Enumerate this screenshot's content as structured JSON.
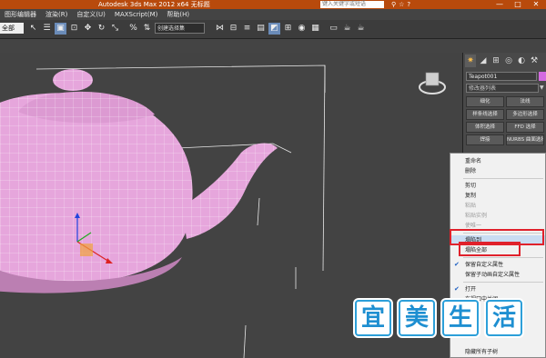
{
  "titlebar": {
    "title": "Autodesk 3ds Max  2012 x64    无标题",
    "search_placeholder": "键入关键字或短语",
    "icons": [
      "binoculars-icon",
      "star-icon",
      "help-icon"
    ],
    "window_buttons": [
      "—",
      "□",
      "✕"
    ]
  },
  "menubar": {
    "items": [
      "图形编辑器",
      "渲染(R)",
      "自定义(U)",
      "MAXScript(M)",
      "帮助(H)"
    ]
  },
  "toolbar": {
    "selection_set": "全部",
    "render_dropdown": "创建选择集"
  },
  "command_panel": {
    "tabs": [
      "create-icon",
      "modify-icon",
      "hierarchy-icon",
      "motion-icon",
      "display-icon",
      "utilities-icon"
    ],
    "object_name": "Teapot001",
    "object_color": "#d36ae0",
    "modifier_list": "修改器列表",
    "modifier_buttons": [
      "细化",
      "法线",
      "样条线选择",
      "多边形选择",
      "体积选择",
      "FFD 选择",
      "焊接",
      "NURBS 曲面选择"
    ]
  },
  "context_menu": {
    "items": [
      {
        "label": "重命名",
        "enabled": true,
        "checked": false
      },
      {
        "label": "删除",
        "enabled": true,
        "checked": false
      },
      {
        "label": "剪切",
        "enabled": true,
        "checked": false
      },
      {
        "label": "复制",
        "enabled": true,
        "checked": false
      },
      {
        "label": "粘贴",
        "enabled": false,
        "checked": false
      },
      {
        "label": "粘贴实例",
        "enabled": false,
        "checked": false
      },
      {
        "label": "使唯一",
        "enabled": false,
        "checked": false
      },
      {
        "label": "塌陷到",
        "enabled": true,
        "checked": false,
        "highlighted": true
      },
      {
        "label": "塌陷全部",
        "enabled": true,
        "checked": false
      },
      {
        "label": "保留自定义属性",
        "enabled": true,
        "checked": true
      },
      {
        "label": "保留子动画自定义属性",
        "enabled": true,
        "checked": false
      },
      {
        "label": "打开",
        "enabled": true,
        "checked": true
      },
      {
        "label": "在视口中关闭",
        "enabled": true,
        "checked": false
      },
      {
        "label": "隐藏所有子树",
        "enabled": true,
        "checked": false
      }
    ]
  },
  "watermark": {
    "characters": [
      "宜",
      "美",
      "生",
      "活"
    ]
  },
  "colors": {
    "titlebar": "#b84a0c",
    "viewport_bg": "#434343",
    "teapot": "#e6a6dc",
    "annotation_red": "#e0212b",
    "selection_blue": "#5b86c7"
  }
}
